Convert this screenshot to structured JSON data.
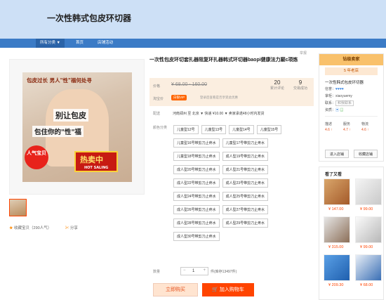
{
  "shop": {
    "name": "一次性韩式包皮环切器"
  },
  "nav": [
    "所有分类",
    "首页",
    "店铺活动"
  ],
  "product": {
    "title": "一次性包皮环切套扎器阻复环扎器韩式环切器baopi健康法力巅c项炼",
    "report": "举报",
    "price_label": "价格",
    "price": "¥ 68.00 - 160.00",
    "taobao_label": "淘宝价",
    "vip_badge": "白银VIP",
    "vip_text": "登录后查看是否享受此优惠",
    "reviews_count": "20",
    "reviews_label": "累计评论",
    "trades_count": "9",
    "trades_label": "交易成功",
    "ship_label": "配送",
    "ship_text": "河南郑州 至  北京 ▼   快递 ¥10.00 ▼   卖家承诺48小时内发货",
    "color_label": "颜色分类",
    "qty_label": "数量",
    "qty_value": "1",
    "stock": "件(库存13497件)",
    "buy_label": "立即购买",
    "cart_label": "加入购物车",
    "favorite": "收藏宝贝（290人气）",
    "share": "分享"
  },
  "photo": {
    "line1": "包皮过长 男人\"性\"福何处寻",
    "line2": "别让包皮",
    "line3": "包住你的\"性\"福",
    "badge": "人气宝贝",
    "hot": "热卖中",
    "hot_en": "HOT SALING"
  },
  "skus": [
    [
      "儿童型12号",
      "儿童型13号",
      "儿童型14号",
      "儿童型15号"
    ],
    [
      "儿童型16号带剪刀止疼水",
      "儿童型17号带剪刀止疼水"
    ],
    [
      "儿童型18号带剪刀止疼水",
      "成人型19号带剪刀止疼水"
    ],
    [
      "成人型20号带剪刀止疼水",
      "成人型21号带剪刀止疼水"
    ],
    [
      "成人型22号带剪刀止疼水",
      "成人型23号带剪刀止疼水"
    ],
    [
      "成人型24号带剪刀止疼水",
      "成人型25号带剪刀止疼水"
    ],
    [
      "成人型26号带剪刀止疼水",
      "成人型27号带剪刀止疼水"
    ],
    [
      "成人型28号带剪刀止疼水",
      "成人型29号带剪刀止疼水"
    ],
    [
      "成人型30号带剪刀止疼水"
    ]
  ],
  "seller": {
    "level": "钻级卖家",
    "years": "5 年老店",
    "name": "一次性韩式包皮环切器",
    "rep_label": "信誉：",
    "owner_label": "掌柜：",
    "owner": "xiaoyuemy",
    "contact_label": "联系：",
    "contact": "和我联系",
    "qual_label": "资质：",
    "scores": [
      {
        "k": "描述",
        "v": "4.6"
      },
      {
        "k": "服务",
        "v": "4.7"
      },
      {
        "k": "物流",
        "v": "4.6"
      }
    ],
    "enter": "进入店铺",
    "fav": "收藏店铺"
  },
  "recommend": {
    "title": "看了又看",
    "prices": [
      "¥ 147.00",
      "¥ 99.00",
      "¥ 315.00",
      "¥ 99.00",
      "¥ 209.30",
      "¥ 68.00"
    ]
  },
  "colors": {
    "accent": "#ff4400",
    "nav": "#3b7bc6",
    "header": "#cde0f6"
  }
}
